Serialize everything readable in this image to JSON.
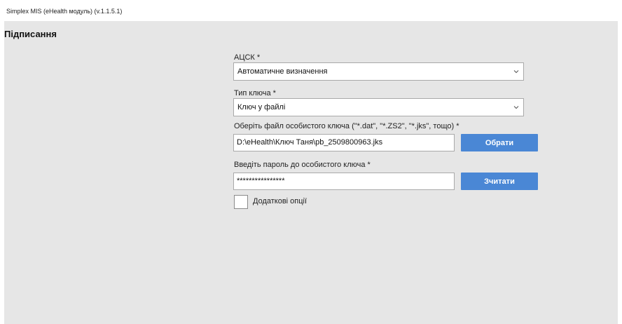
{
  "window": {
    "title": "Simplex MIS (eHealth модуль) (v.1.1.5.1)"
  },
  "page": {
    "title": "Підписання"
  },
  "form": {
    "acsk": {
      "label": "АЦСК *",
      "value": "Автоматичне визначення"
    },
    "key_type": {
      "label": "Тип ключа *",
      "value": "Ключ у файлі"
    },
    "key_file": {
      "label": "Оберіть файл особистого ключа (\"*.dat\", \"*.ZS2\", \"*.jks\", тощо) *",
      "value": "D:\\eHealth\\Ключ Таня\\pb_2509800963.jks",
      "button": "Обрати"
    },
    "password": {
      "label": "Введіть пароль до особистого ключа *",
      "value": "****************",
      "button": "Зчитати"
    },
    "extra_options": {
      "label": "Додаткові опції",
      "checked": false
    }
  },
  "colors": {
    "accent": "#4a87d5",
    "background": "#e6e6e6"
  },
  "icons": {
    "dropdown": "chevron-down-icon"
  }
}
